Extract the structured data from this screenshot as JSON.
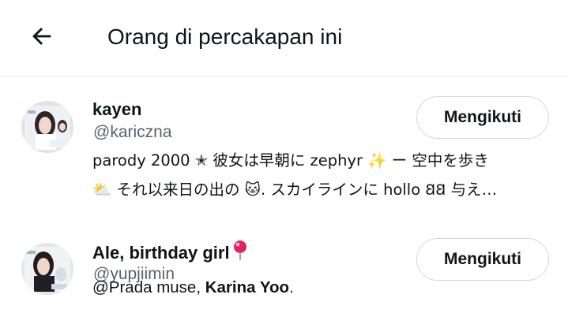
{
  "header": {
    "back_icon": "arrow-left-icon",
    "title": "Orang di percakapan ini"
  },
  "users": [
    {
      "name": "kayen",
      "handle": "@kariczna",
      "follow_label": "Mengikuti",
      "bio_line1": "parody 2000 ✭ 彼女は早朝に zephyr ✨ ー 空中を歩き",
      "bio_line2": "⛅ それ以来日の出の 🐱. スカイラインに hollo 𐐒𐐒 与え…"
    },
    {
      "name_bold": "Ale",
      "name_rest": ", birthday girl",
      "name_emoji": "pin-icon",
      "handle": "@yupjiimin",
      "follow_label": "Mengikuti",
      "bio_prefix": "@Prada muse, ",
      "bio_bold": "Karina Yoo",
      "bio_suffix": "."
    }
  ],
  "colors": {
    "text": "#0f1419",
    "secondary": "#536471",
    "border": "#cfd9de",
    "divider": "#e6e8ea",
    "pin": "#e0245e"
  }
}
